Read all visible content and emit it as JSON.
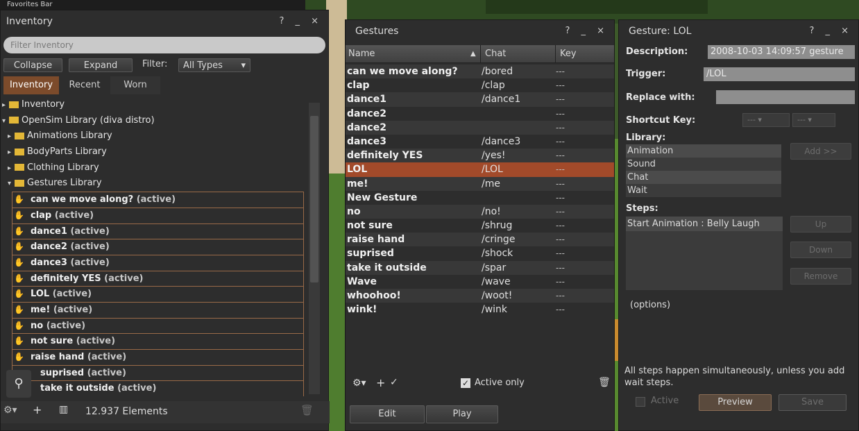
{
  "favorites_bar": {
    "label": "Favorites Bar"
  },
  "inventory": {
    "title": "Inventory",
    "controls": "? _ ×",
    "filter_placeholder": "Filter Inventory",
    "collapse_label": "Collapse",
    "expand_label": "Expand",
    "filter_label": "Filter:",
    "filter_value": "All Types",
    "tabs": [
      {
        "label": "Inventory",
        "active": true
      },
      {
        "label": "Recent",
        "active": false
      },
      {
        "label": "Worn",
        "active": false
      }
    ],
    "tree": {
      "root": "Inventory",
      "library": "OpenSim Library (diva distro)",
      "animations": "Animations Library",
      "bodyparts": "BodyParts Library",
      "clothing": "Clothing Library",
      "gestures": "Gestures Library"
    },
    "gesture_items": [
      {
        "name": "can we move along?",
        "status": "(active)"
      },
      {
        "name": "clap",
        "status": "(active)"
      },
      {
        "name": "dance1",
        "status": "(active)"
      },
      {
        "name": "dance2",
        "status": "(active)"
      },
      {
        "name": "dance3",
        "status": "(active)"
      },
      {
        "name": "definitely YES",
        "status": "(active)"
      },
      {
        "name": "LOL",
        "status": "(active)"
      },
      {
        "name": "me!",
        "status": "(active)"
      },
      {
        "name": "no",
        "status": "(active)"
      },
      {
        "name": "not sure",
        "status": "(active)"
      },
      {
        "name": "raise hand",
        "status": "(active)"
      },
      {
        "name": "suprised",
        "status": "(active)"
      },
      {
        "name": "take it outside",
        "status": "(active)"
      }
    ],
    "element_count": "12.937 Elements"
  },
  "gestures": {
    "title": "Gestures",
    "controls": "? _ ×",
    "col_name": "Name",
    "col_chat": "Chat",
    "col_key": "Key",
    "rows": [
      {
        "name": "can we move along?",
        "chat": "/bored",
        "key": "---"
      },
      {
        "name": "clap",
        "chat": "/clap",
        "key": "---"
      },
      {
        "name": "dance1",
        "chat": "/dance1",
        "key": "---"
      },
      {
        "name": "dance2",
        "chat": "",
        "key": "---"
      },
      {
        "name": "dance2",
        "chat": "",
        "key": "---"
      },
      {
        "name": "dance3",
        "chat": "/dance3",
        "key": "---"
      },
      {
        "name": "definitely YES",
        "chat": "/yes!",
        "key": "---"
      },
      {
        "name": "LOL",
        "chat": "/LOL",
        "key": "---"
      },
      {
        "name": "me!",
        "chat": "/me",
        "key": "---"
      },
      {
        "name": "New Gesture",
        "chat": "",
        "key": "---"
      },
      {
        "name": "no",
        "chat": "/no!",
        "key": "---"
      },
      {
        "name": "not sure",
        "chat": "/shrug",
        "key": "---"
      },
      {
        "name": "raise hand",
        "chat": "/cringe",
        "key": "---"
      },
      {
        "name": "suprised",
        "chat": "/shock",
        "key": "---"
      },
      {
        "name": "take it outside",
        "chat": "/spar",
        "key": "---"
      },
      {
        "name": "Wave",
        "chat": "/wave",
        "key": "---"
      },
      {
        "name": "whoohoo!",
        "chat": "/woot!",
        "key": "---"
      },
      {
        "name": "wink!",
        "chat": "/wink",
        "key": "---"
      }
    ],
    "active_only_label": "Active only",
    "edit_label": "Edit",
    "play_label": "Play"
  },
  "detail": {
    "title": "Gesture: LOL",
    "controls": "? _ ×",
    "description_label": "Description:",
    "description_value": "2008-10-03 14:09:57 gesture",
    "trigger_label": "Trigger:",
    "trigger_value": "/LOL",
    "replace_label": "Replace with:",
    "replace_value": "",
    "shortcut_label": "Shortcut Key:",
    "shortcut_mod": "---",
    "shortcut_key": "---",
    "library_label": "Library:",
    "library_items": [
      "Animation",
      "Sound",
      "Chat",
      "Wait"
    ],
    "add_label": "Add >>",
    "steps_label": "Steps:",
    "step_1": "Start Animation :  Belly Laugh",
    "up_label": "Up",
    "down_label": "Down",
    "remove_label": "Remove",
    "options_label": "(options)",
    "note": "All steps happen simultaneously, unless you add wait steps.",
    "active_label": "Active",
    "preview_label": "Preview",
    "save_label": "Save"
  }
}
